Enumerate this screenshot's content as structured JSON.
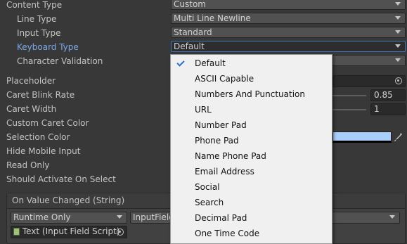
{
  "inspector": {
    "labels": {
      "content_type": "Content Type",
      "line_type": "Line Type",
      "input_type": "Input Type",
      "keyboard_type": "Keyboard Type",
      "character_validation": "Character Validation",
      "placeholder": "Placeholder",
      "caret_blink_rate": "Caret Blink Rate",
      "caret_width": "Caret Width",
      "custom_caret_color": "Custom Caret Color",
      "selection_color": "Selection Color",
      "hide_mobile_input": "Hide Mobile Input",
      "read_only": "Read Only",
      "should_activate_on_select": "Should Activate On Select"
    },
    "values": {
      "content_type": "Custom",
      "line_type": "Multi Line Newline",
      "input_type": "Standard",
      "keyboard_type": "Default",
      "caret_blink_rate": "0.85",
      "caret_width": "1"
    },
    "colors": {
      "selection_color": "#a8cef9",
      "active_label": "#7ba9e6",
      "focus_border": "#3a79bb"
    }
  },
  "event": {
    "header": "On Value Changed (String)",
    "runtime": "Runtime Only",
    "function_partial": "InputField",
    "target": "Text (Input Field Script)"
  },
  "keyboard_menu": {
    "items": [
      "Default",
      "ASCII Capable",
      "Numbers And Punctuation",
      "URL",
      "Number Pad",
      "Phone Pad",
      "Name Phone Pad",
      "Email Address",
      "Social",
      "Search",
      "Decimal Pad",
      "One Time Code"
    ],
    "selected_index": 0
  }
}
